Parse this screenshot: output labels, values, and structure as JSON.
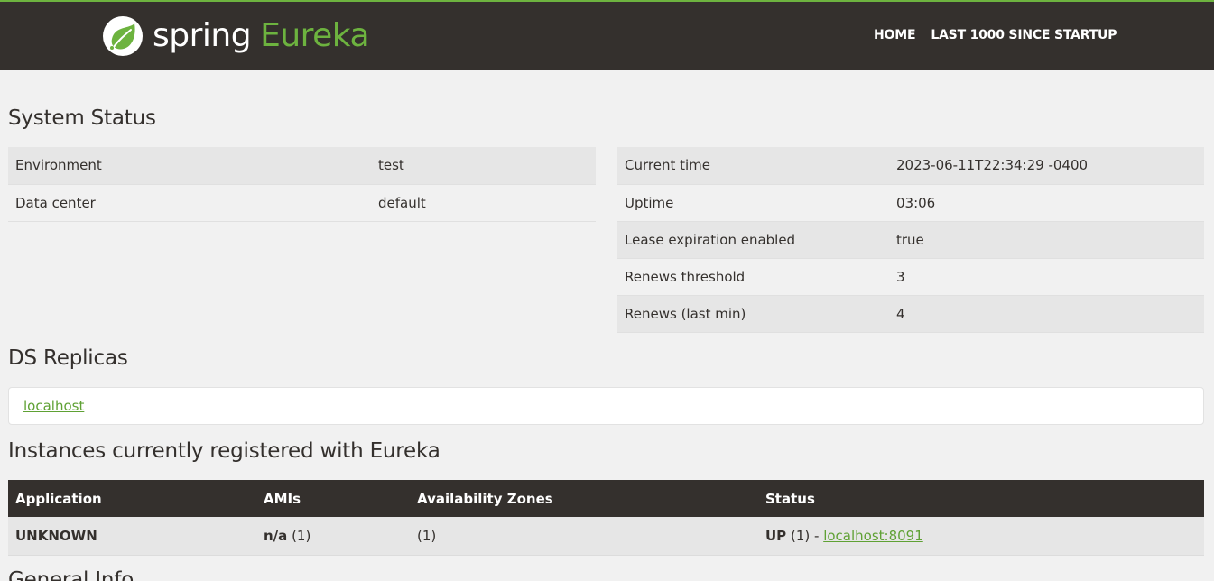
{
  "nav": {
    "brand_spring": "spring",
    "brand_eureka": "Eureka",
    "links": [
      "HOME",
      "LAST 1000 SINCE STARTUP"
    ]
  },
  "system_status": {
    "title": "System Status",
    "left": [
      {
        "label": "Environment",
        "value": "test"
      },
      {
        "label": "Data center",
        "value": "default"
      }
    ],
    "right": [
      {
        "label": "Current time",
        "value": "2023-06-11T22:34:29 -0400"
      },
      {
        "label": "Uptime",
        "value": "03:06"
      },
      {
        "label": "Lease expiration enabled",
        "value": "true"
      },
      {
        "label": "Renews threshold",
        "value": "3"
      },
      {
        "label": "Renews (last min)",
        "value": "4"
      }
    ]
  },
  "ds_replicas": {
    "title": "DS Replicas",
    "link": "localhost"
  },
  "instances": {
    "title": "Instances currently registered with Eureka",
    "headers": [
      "Application",
      "AMIs",
      "Availability Zones",
      "Status"
    ],
    "rows": [
      {
        "application": "UNKNOWN",
        "ami_bold": "n/a",
        "ami_count": "(1)",
        "zones": "(1)",
        "status_bold": "UP",
        "status_count": "(1) -",
        "status_link": "localhost:8091"
      }
    ]
  },
  "general_info": {
    "title": "General Info"
  },
  "colors": {
    "brand_green": "#6db33f",
    "header_dark": "#34302d",
    "page_bg": "#f1f1f1"
  }
}
